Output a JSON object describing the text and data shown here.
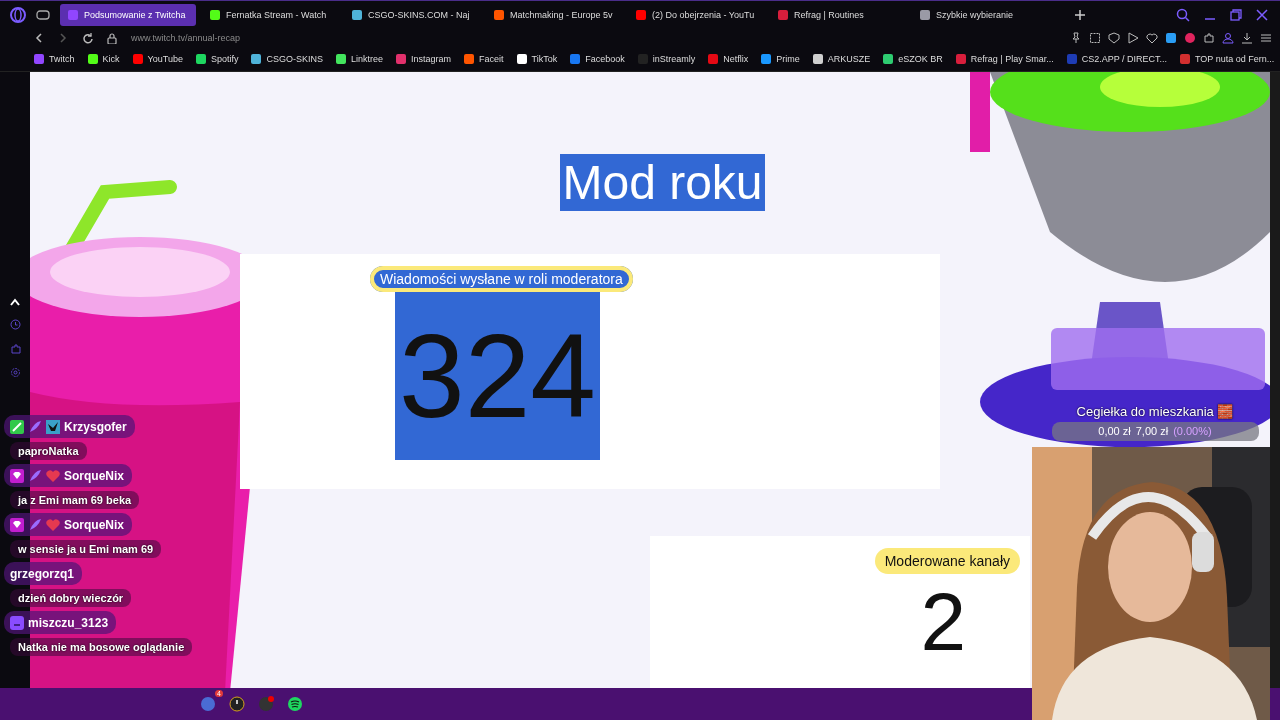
{
  "browser": {
    "tabs": [
      {
        "title": "Podsumowanie z Twitcha",
        "selected": true,
        "color": "#9146ff"
      },
      {
        "title": "Fernatka Stream - Watch",
        "selected": false,
        "color": "#53fc18"
      },
      {
        "title": "CSGO-SKINS.COM - Naj",
        "selected": false,
        "color": "#4fb3d9"
      },
      {
        "title": "Matchmaking - Europe 5v",
        "selected": false,
        "color": "#ff5500"
      },
      {
        "title": "(2) Do obejrzenia - YouTu",
        "selected": false,
        "color": "#ff0000"
      },
      {
        "title": "Refrag | Routines",
        "selected": false,
        "color": "#d81e3c"
      },
      {
        "title": "Szybkie wybieranie",
        "selected": false,
        "color": "#9a9aa6"
      }
    ],
    "address": "www.twitch.tv/annual-recap",
    "bookmarks": [
      {
        "label": "Twitch",
        "color": "#9146ff"
      },
      {
        "label": "Kick",
        "color": "#53fc18"
      },
      {
        "label": "YouTube",
        "color": "#ff0000"
      },
      {
        "label": "Spotify",
        "color": "#1ed760"
      },
      {
        "label": "CSGO-SKINS",
        "color": "#4fb3d9"
      },
      {
        "label": "Linktree",
        "color": "#43e55e"
      },
      {
        "label": "Instagram",
        "color": "#e1306c"
      },
      {
        "label": "Faceit",
        "color": "#ff5500"
      },
      {
        "label": "TikTok",
        "color": "#ffffff"
      },
      {
        "label": "Facebook",
        "color": "#1877f2"
      },
      {
        "label": "inStreamly",
        "color": "#222222"
      },
      {
        "label": "Netflix",
        "color": "#e50914"
      },
      {
        "label": "Prime",
        "color": "#1a98ff"
      },
      {
        "label": "ARKUSZE",
        "color": "#cfcfcf"
      },
      {
        "label": "eSZOK BR",
        "color": "#2ecc71"
      },
      {
        "label": "Refrag | Play Smar...",
        "color": "#d81e3c"
      },
      {
        "label": "CS2.APP / DIRECT...",
        "color": "#1e3cb4"
      },
      {
        "label": "TOP nuta od Fern...",
        "color": "#d32f2f"
      }
    ]
  },
  "recap": {
    "title": {
      "text": "Mod roku",
      "highlighted": true
    },
    "cards": [
      {
        "label": "Wiadomości wysłane w roli moderatora",
        "value": "324",
        "highlighted": true
      },
      {
        "label": "Moderowane kanały",
        "value": "2",
        "highlighted": false
      }
    ]
  },
  "goal": {
    "title": "Cegiełka do mieszkania 🧱",
    "current": "0,00 zł",
    "target": "7,00 zł",
    "percent": "(0.00%)",
    "level": 0
  },
  "chat": [
    {
      "user": "Krzysgofer",
      "kind": "moderator",
      "text": "paproNatka"
    },
    {
      "user": "SorqueNix",
      "kind": "subscriber",
      "text": "ja z Emi mam 69 beka"
    },
    {
      "user": "SorqueNix",
      "kind": "subscriber",
      "text": "w sensie ja u Emi mam 69"
    },
    {
      "user": "grzegorzq1",
      "kind": "plain",
      "text": "dzień dobry wieczór"
    },
    {
      "user": "miszczu_3123",
      "kind": "bot",
      "text": "Natka nie ma bosowe oglądanie"
    }
  ],
  "taskbar": {
    "badge": "4"
  }
}
